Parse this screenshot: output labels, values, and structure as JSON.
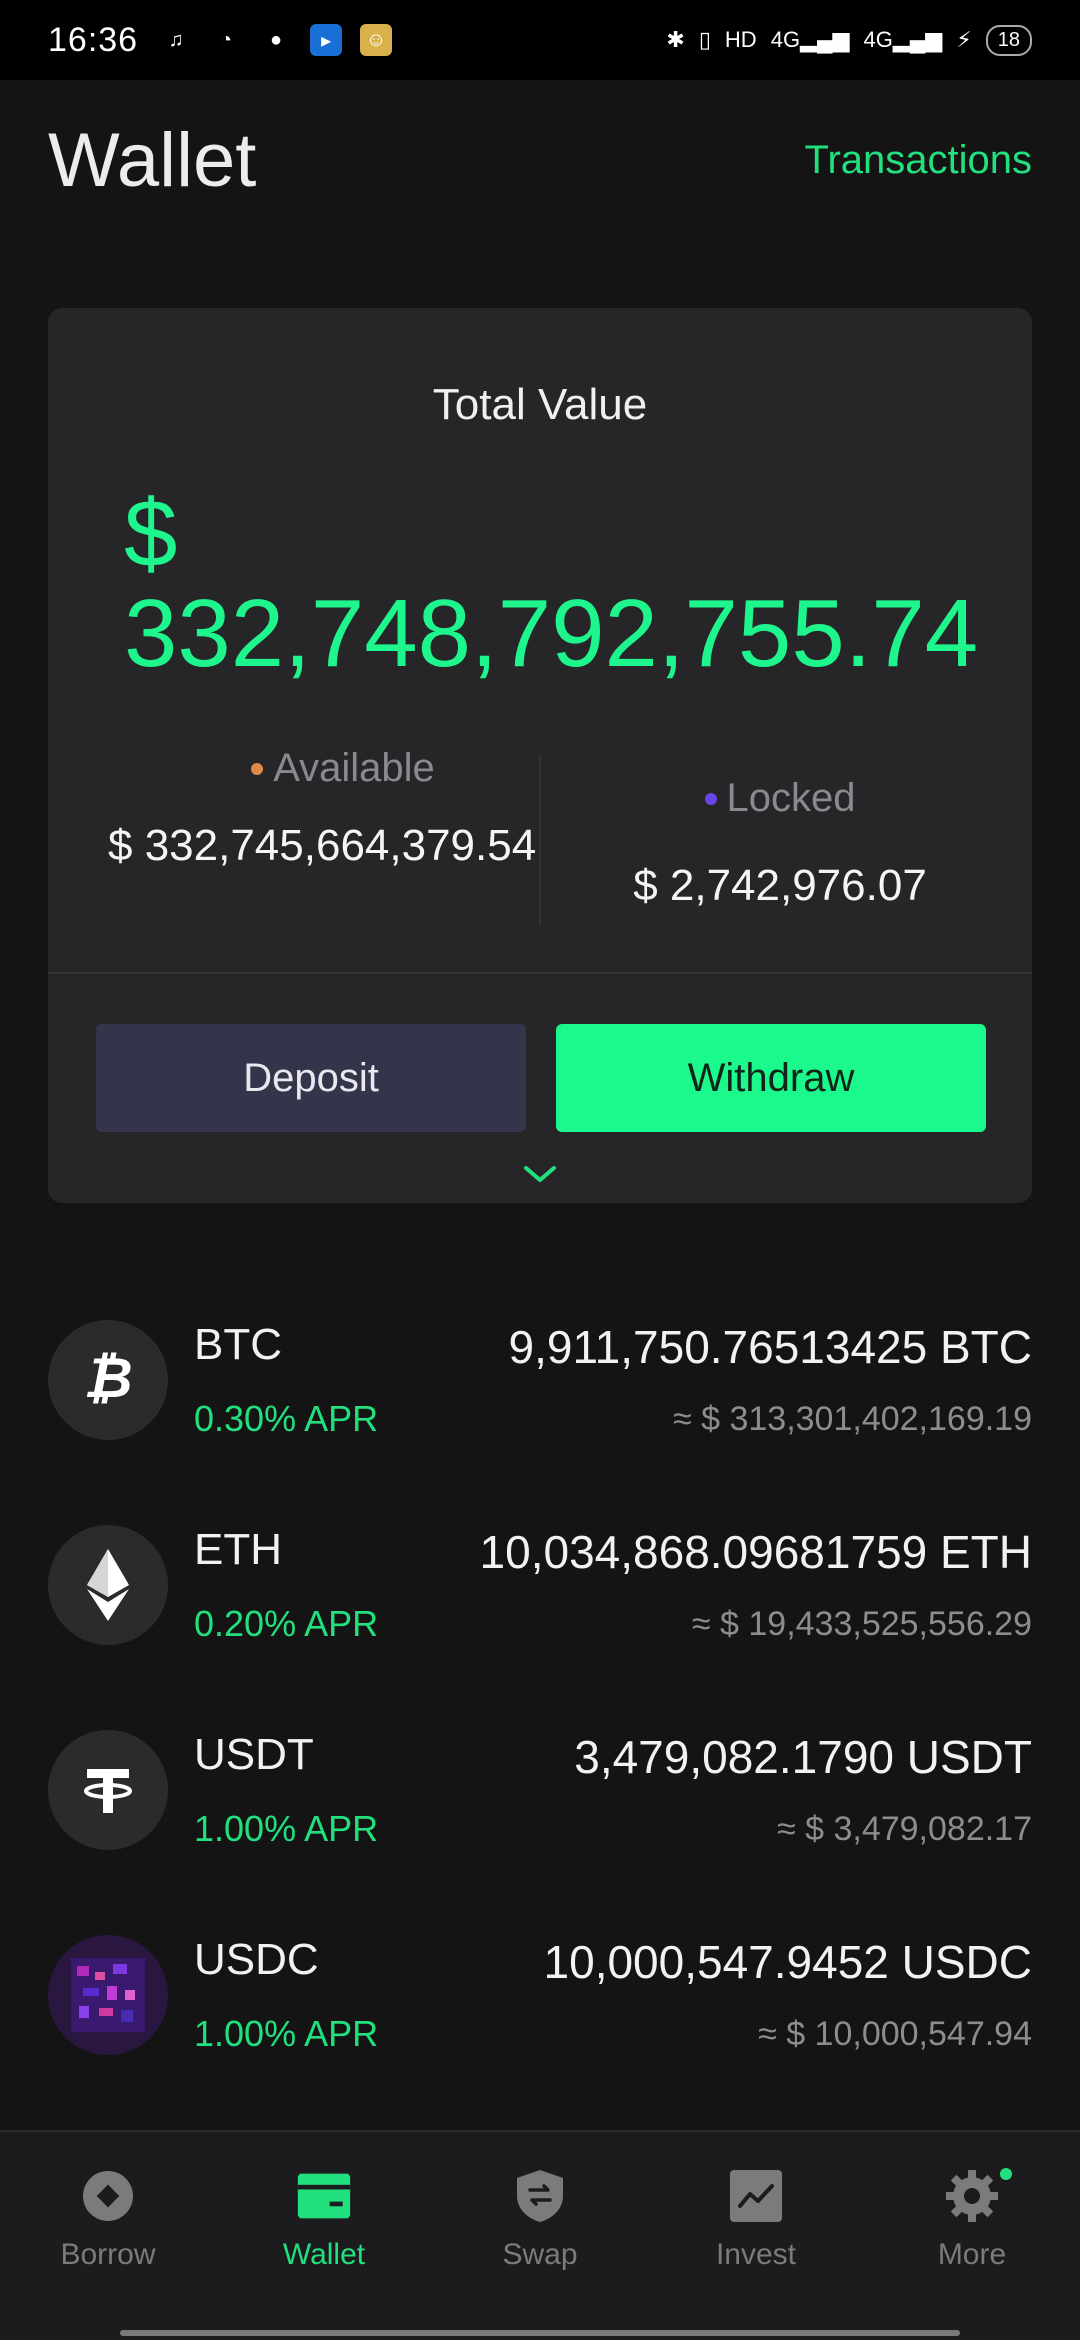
{
  "status_bar": {
    "time": "16:36",
    "network": "4G",
    "network2": "4G",
    "battery": "18"
  },
  "header": {
    "title": "Wallet",
    "transactions_link": "Transactions"
  },
  "summary": {
    "label": "Total Value",
    "total_value": "$ 332,748,792,755.74",
    "available_label": "Available",
    "available_value": "$ 332,745,664,379.54",
    "locked_label": "Locked",
    "locked_value": "$ 2,742,976.07",
    "deposit_label": "Deposit",
    "withdraw_label": "Withdraw"
  },
  "assets": [
    {
      "symbol": "BTC",
      "apr": "0.30% APR",
      "balance": "9,911,750.76513425 BTC",
      "usd": "≈ $ 313,301,402,169.19",
      "icon": "bitcoin-icon"
    },
    {
      "symbol": "ETH",
      "apr": "0.20% APR",
      "balance": "10,034,868.09681759 ETH",
      "usd": "≈ $ 19,433,525,556.29",
      "icon": "ethereum-icon"
    },
    {
      "symbol": "USDT",
      "apr": "1.00% APR",
      "balance": "3,479,082.1790 USDT",
      "usd": "≈ $ 3,479,082.17",
      "icon": "tether-icon"
    },
    {
      "symbol": "USDC",
      "apr": "1.00% APR",
      "balance": "10,000,547.9452 USDC",
      "usd": "≈ $ 10,000,547.94",
      "icon": "usdc-icon"
    }
  ],
  "nav": [
    {
      "label": "Borrow",
      "icon": "borrow-icon"
    },
    {
      "label": "Wallet",
      "icon": "wallet-icon"
    },
    {
      "label": "Swap",
      "icon": "swap-icon"
    },
    {
      "label": "Invest",
      "icon": "invest-icon"
    },
    {
      "label": "More",
      "icon": "gear-icon"
    }
  ],
  "colors": {
    "accent": "#21e07d",
    "total_value": "#1ff58d",
    "withdraw_bg": "#1cf98c",
    "deposit_bg": "#34344a",
    "available_dot": "#e08a4a",
    "locked_dot": "#6a45e8",
    "card_bg": "#262628",
    "page_bg": "#141415"
  }
}
